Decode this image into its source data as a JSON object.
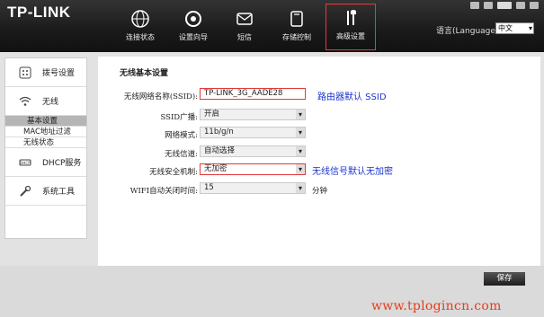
{
  "header": {
    "logo": "TP-LINK",
    "nav": [
      {
        "label": "连接状态",
        "icon": "globe-icon"
      },
      {
        "label": "设置向导",
        "icon": "wizard-icon"
      },
      {
        "label": "短信",
        "icon": "message-icon"
      },
      {
        "label": "存储控制",
        "icon": "storage-icon"
      },
      {
        "label": "高级设置",
        "icon": "tools-icon",
        "active": true
      }
    ],
    "language_label": "语言(Language):",
    "language_value": "中文"
  },
  "sidebar": {
    "groups": [
      {
        "label": "拨号设置",
        "icon": "dial-icon"
      },
      {
        "label": "无线",
        "icon": "wifi-icon"
      }
    ],
    "wireless_sub": [
      {
        "label": "基本设置",
        "active": true
      },
      {
        "label": "MAC地址过滤"
      },
      {
        "label": "无线状态"
      }
    ],
    "groups2": [
      {
        "label": "DHCP服务",
        "icon": "dhcp-icon"
      },
      {
        "label": "系统工具",
        "icon": "wrench-icon"
      }
    ]
  },
  "main": {
    "title": "无线基本设置",
    "fields": {
      "ssid_label": "无线网络名称(SSID):",
      "ssid_value": "TP-LINK_3G_AADE28",
      "ssid_broadcast_label": "SSID广播:",
      "ssid_broadcast_value": "开启",
      "mode_label": "网络模式:",
      "mode_value": "11b/g/n",
      "channel_label": "无线信道:",
      "channel_value": "自动选择",
      "security_label": "无线安全机制:",
      "security_value": "无加密",
      "wifi_off_label": "WIFI自动关闭时间:",
      "wifi_off_value": "15",
      "wifi_off_unit": "分钟"
    },
    "annotations": {
      "ssid_note": "路由器默认 SSID",
      "security_note": "无线信号默认无加密"
    }
  },
  "footer": {
    "save_label": "保存",
    "watermark": "www.tplogincn.com"
  },
  "colors": {
    "accent_red": "#e23a3a",
    "annotation_blue": "#1b33cf",
    "header_bg": "#1a1a1a"
  }
}
